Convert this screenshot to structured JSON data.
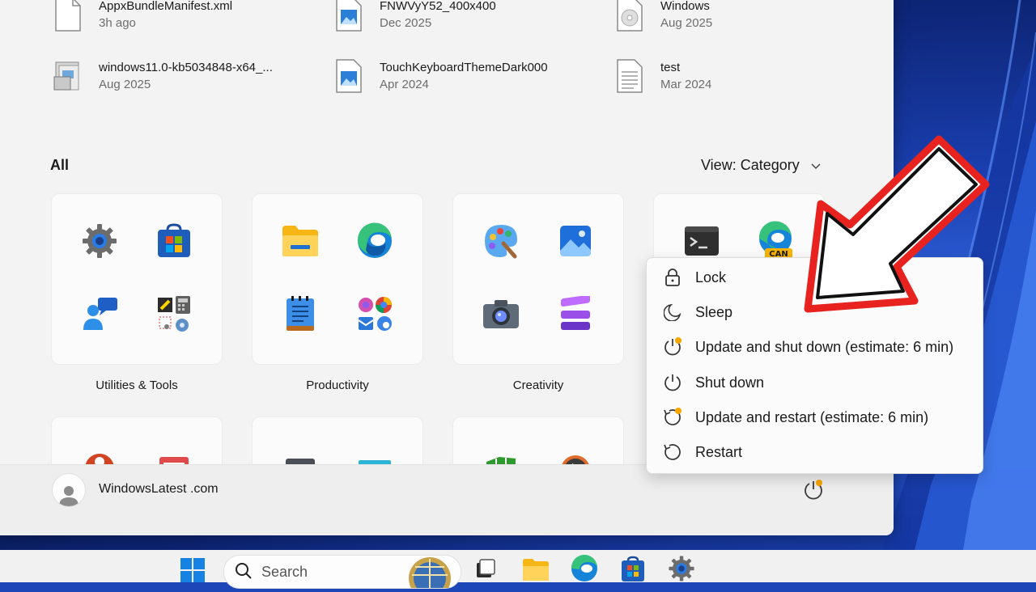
{
  "recent_files": [
    {
      "name": "AppxBundleManifest.xml",
      "date": "3h ago",
      "icon": "document-icon"
    },
    {
      "name": "FNWVyY52_400x400",
      "date": "Dec 2025",
      "icon": "image-file-icon"
    },
    {
      "name": "Windows",
      "date": "Aug 2025",
      "icon": "disc-image-icon"
    },
    {
      "name": "windows11.0-kb5034848-x64_...",
      "date": "Aug 2025",
      "icon": "installer-package-icon"
    },
    {
      "name": "TouchKeyboardThemeDark000",
      "date": "Apr 2024",
      "icon": "image-file-icon"
    },
    {
      "name": "test",
      "date": "Mar 2024",
      "icon": "text-file-icon"
    }
  ],
  "all_section": {
    "title": "All",
    "view_label": "View: Category"
  },
  "categories": [
    {
      "label": "Utilities & Tools",
      "icons": [
        "settings-gear-icon",
        "microsoft-store-icon",
        "get-help-icon",
        "utilities-folder-icon"
      ]
    },
    {
      "label": "Productivity",
      "icons": [
        "file-explorer-icon",
        "edge-browser-icon",
        "notepad-icon",
        "apps-group-icon"
      ]
    },
    {
      "label": "Creativity",
      "icons": [
        "paint-icon",
        "photos-icon",
        "camera-icon",
        "clipchamp-icon"
      ]
    },
    {
      "label": "",
      "icons": [
        "terminal-icon",
        "edge-canary-icon"
      ],
      "badge": "CAN"
    }
  ],
  "power_menu": {
    "items": [
      {
        "label": "Lock",
        "icon": "lock-icon"
      },
      {
        "label": "Sleep",
        "icon": "moon-icon"
      },
      {
        "label": "Update and shut down (estimate: 6 min)",
        "icon": "power-update-icon"
      },
      {
        "label": "Shut down",
        "icon": "power-icon"
      },
      {
        "label": "Update and restart (estimate: 6 min)",
        "icon": "restart-update-icon"
      },
      {
        "label": "Restart",
        "icon": "restart-icon"
      }
    ]
  },
  "footer": {
    "user_name": "WindowsLatest .com"
  },
  "taskbar": {
    "search_placeholder": "Search"
  },
  "colors": {
    "annotation_arrow": "#e8231f",
    "update_dot": "#f7a600",
    "accent": "#0067c0"
  }
}
